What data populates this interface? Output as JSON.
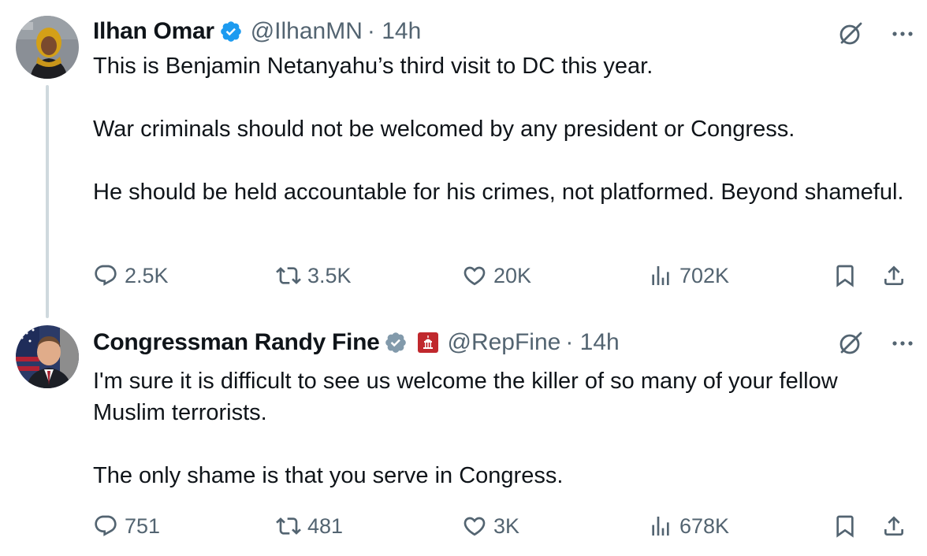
{
  "tweets": [
    {
      "author": {
        "name": "Ilhan Omar",
        "handle": "@IlhanMN",
        "time": "· 14h",
        "verified_color": "#1d9bf0"
      },
      "text": [
        "This is Benjamin Netanyahu’s third visit to DC this year.",
        "",
        "War criminals should not be welcomed by any president or Congress.",
        "",
        "He should be held accountable for his crimes, not platformed. Beyond shameful."
      ],
      "stats": {
        "replies": "2.5K",
        "reposts": "3.5K",
        "likes": "20K",
        "views": "702K"
      },
      "icons": [
        "reply-icon",
        "repost-icon",
        "like-icon",
        "views-icon",
        "bookmark-icon",
        "share-icon",
        "grok-icon",
        "more-icon"
      ]
    },
    {
      "author": {
        "name": "Congressman Randy Fine",
        "handle": "@RepFine",
        "time": "· 14h",
        "verified_color": "#829aab",
        "affiliation_color": "#c0282d"
      },
      "text": [
        "I'm sure it is difficult to see us welcome the killer of so many of your fellow Muslim terrorists.",
        "",
        "The only shame is that you serve in Congress."
      ],
      "stats": {
        "replies": "751",
        "reposts": "481",
        "likes": "3K",
        "views": "678K"
      },
      "icons": [
        "reply-icon",
        "repost-icon",
        "like-icon",
        "views-icon",
        "bookmark-icon",
        "share-icon",
        "grok-icon",
        "more-icon"
      ]
    }
  ],
  "colors": {
    "text_primary": "#0f1419",
    "text_secondary": "#536471",
    "thread_line": "#cfd9de"
  }
}
